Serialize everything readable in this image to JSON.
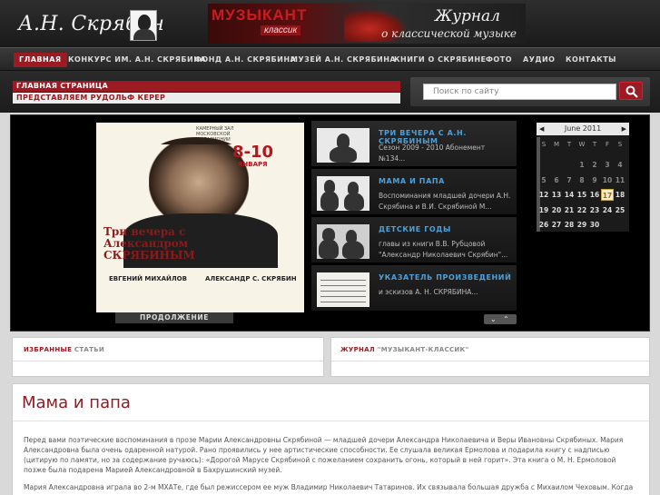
{
  "header": {
    "logo_text": "А.Н. Скрябин",
    "banner": {
      "brand": "МУЗЫКАНТ",
      "brand_sub": "классик",
      "title": "Журнал",
      "subtitle": "о классической музыке"
    }
  },
  "nav": {
    "items": [
      {
        "label": "ГЛАВНАЯ",
        "active": true
      },
      {
        "label": "КОНКУРС ИМ. А.Н. СКРЯБИНА"
      },
      {
        "label": "ФОНД А.Н. СКРЯБИНА"
      },
      {
        "label": "МУЗЕЙ А.Н. СКРЯБИНА"
      },
      {
        "label": "КНИГИ О СКРЯБИНЕ"
      },
      {
        "label": "ФОТО"
      },
      {
        "label": "АУДИО"
      },
      {
        "label": "КОНТАКТЫ"
      }
    ]
  },
  "breadcrumbs": {
    "home": "ГЛАВНАЯ СТРАНИЦА",
    "current": "ПРЕДСТАВЛЯЕМ РУДОЛЬФ КЕРЕР"
  },
  "search": {
    "placeholder": "Поиск по сайту"
  },
  "showcase": {
    "poster": {
      "header_small": "КАМЕРНЫЙ ЗАЛ МОСКОВСКОЙ ФИЛАРМОНИИ",
      "date": "8-10",
      "month": "ЯНВАРЯ",
      "title": "Три вечера с Александром СКРЯБИНЫМ",
      "performer": "ЕВГЕНИЙ МИХАЙЛОВ",
      "program": "АЛЕКСАНДР С. СКРЯБИН"
    },
    "more_label": "ПРОДОЛЖЕНИЕ",
    "features": [
      {
        "title": "ТРИ ВЕЧЕРА С А.Н. СКРЯБИНЫМ",
        "desc": "Сезон 2009 - 2010 Абонемент №134..."
      },
      {
        "title": "МАМА И ПАПА",
        "desc": "Воспоминания младшей дочери А.Н. Скрябина и В.И. Скрябиной М..."
      },
      {
        "title": "ДЕТСКИЕ ГОДЫ",
        "desc": "главы из книги В.В. Рубцовой \"Александр Николаевич Скрябин\"..."
      },
      {
        "title": "УКАЗАТЕЛЬ ПРОИЗВЕДЕНИЙ",
        "desc": "и эскизов А. Н. СКРЯБИНА..."
      }
    ],
    "arrows_icons": [
      "chevron-down-icon",
      "chevron-up-icon"
    ]
  },
  "calendar": {
    "title": "June 2011",
    "prev": "◀",
    "next": "▶",
    "dow": [
      "S",
      "M",
      "T",
      "W",
      "T",
      "F",
      "S"
    ],
    "weeks": [
      [
        "",
        "",
        "",
        "1",
        "2",
        "3",
        "4"
      ],
      [
        "5",
        "6",
        "7",
        "8",
        "9",
        "10",
        "11"
      ],
      [
        "12",
        "13",
        "14",
        "15",
        "16",
        "17",
        "18"
      ],
      [
        "19",
        "20",
        "21",
        "22",
        "23",
        "24",
        "25"
      ],
      [
        "26",
        "27",
        "28",
        "29",
        "30",
        "",
        ""
      ]
    ],
    "today": "17"
  },
  "sections": {
    "featured_highlight": "ИЗБРАННЫЕ",
    "featured_rest": "СТАТЬИ",
    "journal_label": "ЖУРНАЛ",
    "journal_name": "\"МУЗЫКАНТ-КЛАССИК\""
  },
  "article": {
    "title": "Мама и папа",
    "paragraphs": [
      "Перед вами поэтические воспоминания в прозе Марии Александровны Скрябиной — младшей дочери Александра Николаевича и Веры Ивановны Скрябиных. Мария Александровна была очень одаренной натурой. Рано проявились у нее артистические способности. Ее слушала великая Ермолова и подарила книгу с надписью (цитирую по памяти, но за содержание ручаюсь): «Дорогой Марусе Скрябиной с пожеланием сохранить огонь, который в ней горит». Эта книга о М. Н. Ермоловой позже была подарена Марией Александровной в Бахрушинский музей.",
      "Мария Александровна играла во 2-м МХАТе, где был режиссером ее муж Владимир Николаевич Татаринов. Их связывала большая дружба с Михаилом Чеховым. Когда"
    ]
  },
  "colors": {
    "accent": "#9c1b23",
    "feature_title": "#4fa0d8",
    "article_title": "#8e1c22"
  }
}
